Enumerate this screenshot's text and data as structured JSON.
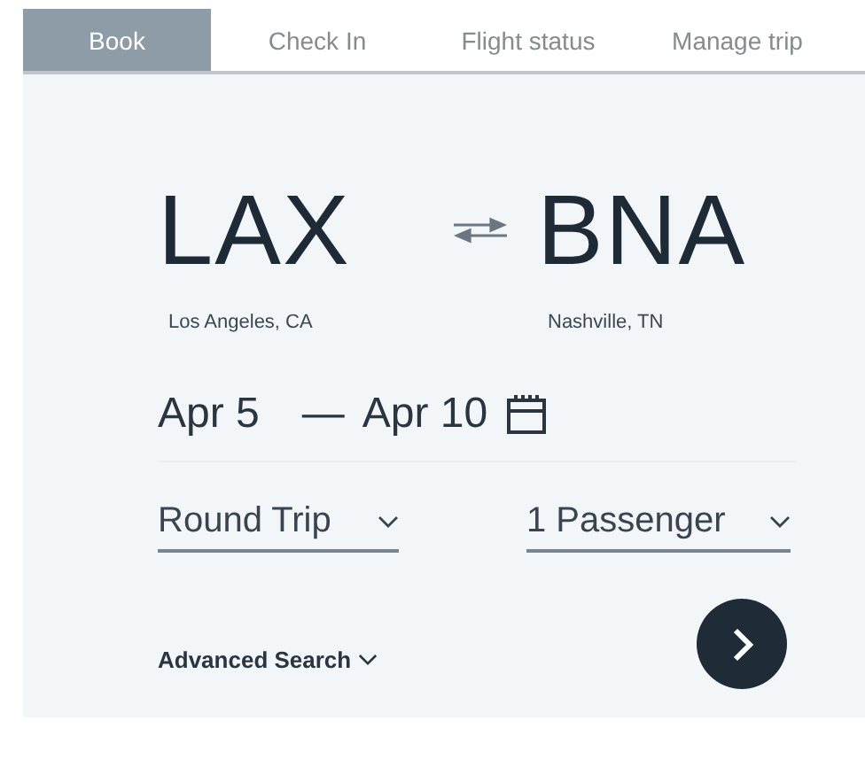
{
  "tabs": [
    {
      "label": "Book",
      "selected": true
    },
    {
      "label": "Check In",
      "selected": false
    },
    {
      "label": "Flight status",
      "selected": false
    },
    {
      "label": "Manage trip",
      "selected": false
    }
  ],
  "origin": {
    "code": "LAX",
    "city": "Los Angeles, CA"
  },
  "destination": {
    "code": "BNA",
    "city": "Nashville, TN"
  },
  "dates": {
    "depart": "Apr 5",
    "separator": "—",
    "return": "Apr 10"
  },
  "trip_type": {
    "value": "Round Trip"
  },
  "passengers": {
    "value": "1 Passenger"
  },
  "advanced_search": {
    "label": "Advanced Search",
    "expanded": false
  }
}
